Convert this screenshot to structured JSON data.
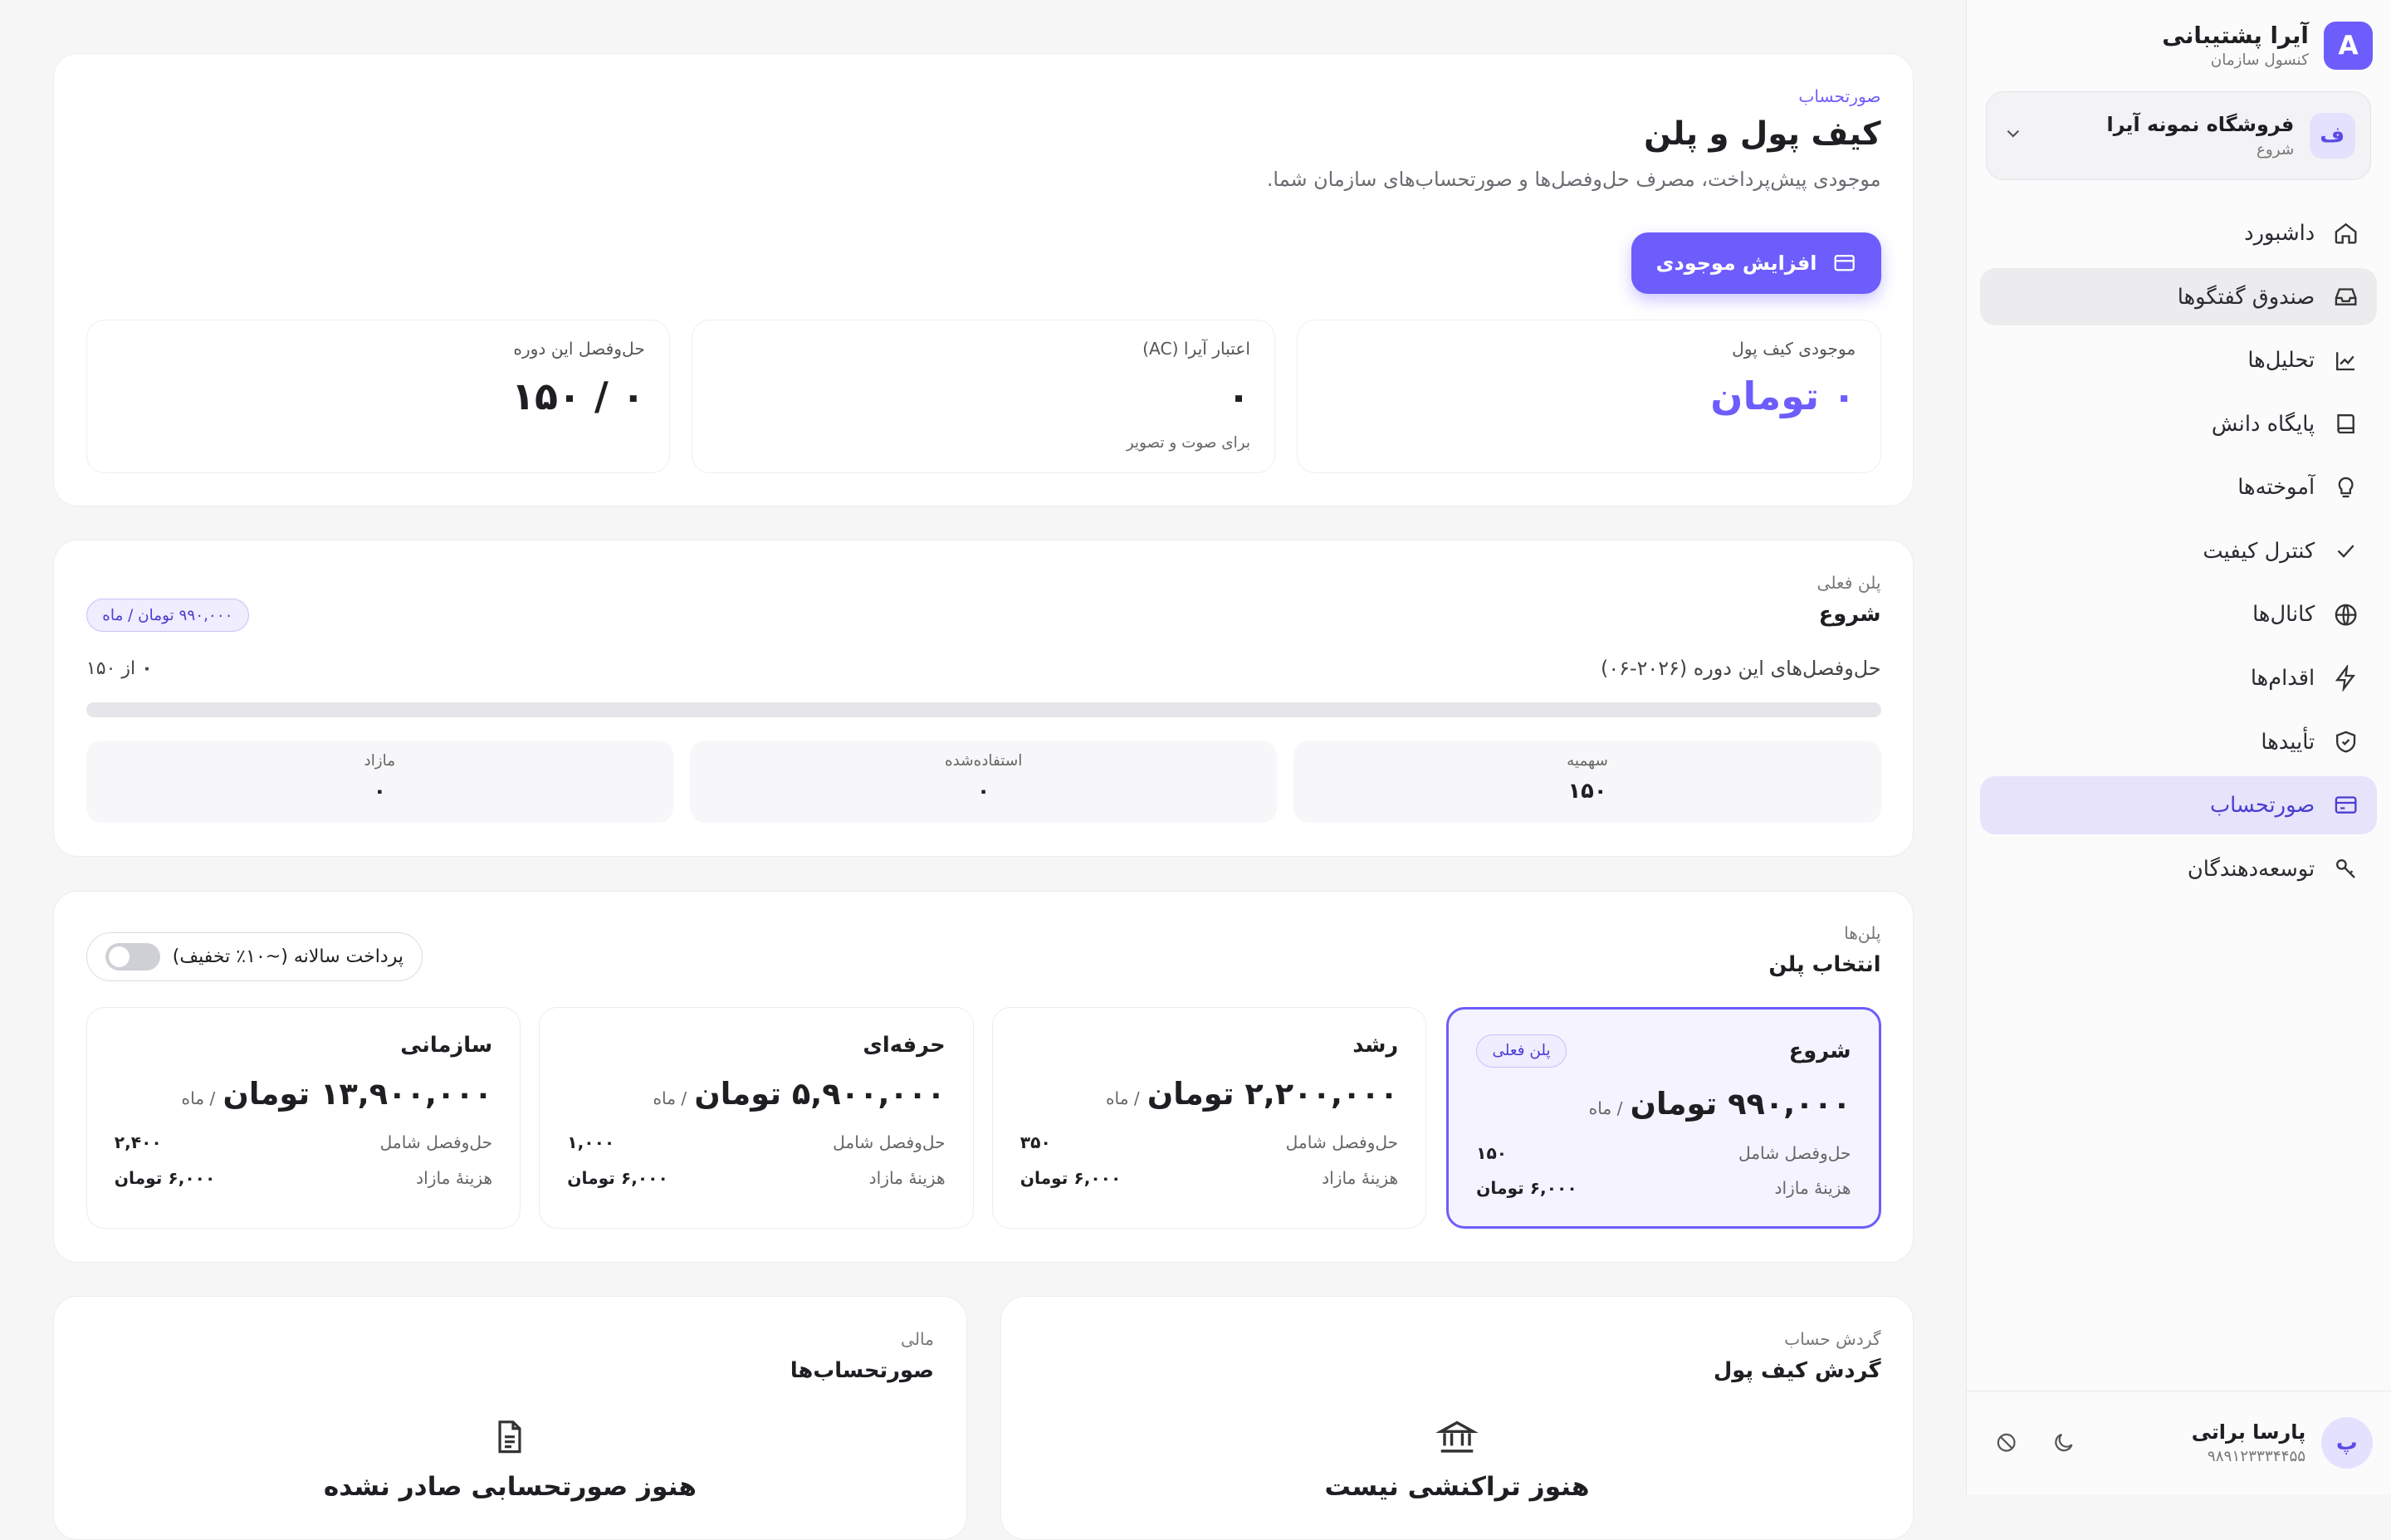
{
  "brand": {
    "logo_letter": "A",
    "name": "آیرا پشتیبانی",
    "subtitle": "کنسول سازمان"
  },
  "org": {
    "avatar": "ف",
    "name": "فروشگاه نمونه آیرا",
    "plan": "شروع"
  },
  "nav": [
    {
      "label": "داشبورد",
      "icon": "home-icon"
    },
    {
      "label": "صندوق گفتگوها",
      "icon": "inbox-icon",
      "state": "hover"
    },
    {
      "label": "تحلیل‌ها",
      "icon": "chart-icon"
    },
    {
      "label": "پایگاه دانش",
      "icon": "book-icon"
    },
    {
      "label": "آموخته‌ها",
      "icon": "bulb-icon"
    },
    {
      "label": "کنترل کیفیت",
      "icon": "check-icon"
    },
    {
      "label": "کانال‌ها",
      "icon": "globe-icon"
    },
    {
      "label": "اقدام‌ها",
      "icon": "bolt-icon"
    },
    {
      "label": "تأییدها",
      "icon": "shield-icon"
    },
    {
      "label": "صورتحساب",
      "icon": "card-icon",
      "state": "active"
    },
    {
      "label": "توسعه‌دهندگان",
      "icon": "key-icon"
    }
  ],
  "user": {
    "avatar": "پ",
    "name": "پارسا براتی",
    "phone": "۹۸۹۱۲۳۳۳۴۴۵۵"
  },
  "header": {
    "eyebrow": "صورتحساب",
    "title": "کیف پول و پلن",
    "description": "موجودی پیش‌پرداخت، مصرف حل‌وفصل‌ها و صورتحساب‌های سازمان شما.",
    "topup_button": "افزایش موجودی"
  },
  "stats": {
    "wallet": {
      "label": "موجودی کیف پول",
      "value": "۰ تومان"
    },
    "credit": {
      "label": "اعتبار آیرا (AC)",
      "value": "۰",
      "sub": "برای صوت و تصویر"
    },
    "resolutions": {
      "label": "حل‌وفصل این دوره",
      "value": "۰ / ۱۵۰"
    }
  },
  "current_plan": {
    "eyebrow": "پلن فعلی",
    "name": "شروع",
    "price_pill": "۹۹۰,۰۰۰ تومان / ماه",
    "period_label": "حل‌وفصل‌های این دوره (۲۰۲۶-۰۶)",
    "usage_used": "۰",
    "usage_text": "از ۱۵۰",
    "usage_fraction": 0,
    "quota_label": "سهمیه",
    "quota_value": "۱۵۰",
    "used_label": "استفاده‌شده",
    "used_value": "۰",
    "overage_label": "مازاد",
    "overage_value": "۰"
  },
  "plans_section": {
    "eyebrow": "پلن‌ها",
    "title": "انتخاب پلن",
    "annual_toggle_label": "پرداخت سالانه (~۱۰٪ تخفیف)",
    "annual_on": false,
    "current_badge": "پلن فعلی",
    "per_month": "/ ماه",
    "included_label": "حل‌وفصل شامل",
    "overage_label": "هزینهٔ مازاد",
    "plans": [
      {
        "name": "شروع",
        "price": "۹۹۰,۰۰۰ تومان",
        "included": "۱۵۰",
        "overage": "۶,۰۰۰ تومان",
        "current": true
      },
      {
        "name": "رشد",
        "price": "۲,۲۰۰,۰۰۰ تومان",
        "included": "۳۵۰",
        "overage": "۶,۰۰۰ تومان"
      },
      {
        "name": "حرفه‌ای",
        "price": "۵,۹۰۰,۰۰۰ تومان",
        "included": "۱,۰۰۰",
        "overage": "۶,۰۰۰ تومان"
      },
      {
        "name": "سازمانی",
        "price": "۱۳,۹۰۰,۰۰۰ تومان",
        "included": "۲,۴۰۰",
        "overage": "۶,۰۰۰ تومان"
      }
    ]
  },
  "wallet_activity": {
    "eyebrow": "گردش حساب",
    "title": "گردش کیف پول",
    "empty": "هنوز تراکنشی نیست"
  },
  "invoices": {
    "eyebrow": "مالی",
    "title": "صورتحساب‌ها",
    "empty": "هنوز صورتحسابی صادر نشده"
  },
  "colors": {
    "accent": "#6d5dfc",
    "accent_soft": "#e6e3fb"
  }
}
